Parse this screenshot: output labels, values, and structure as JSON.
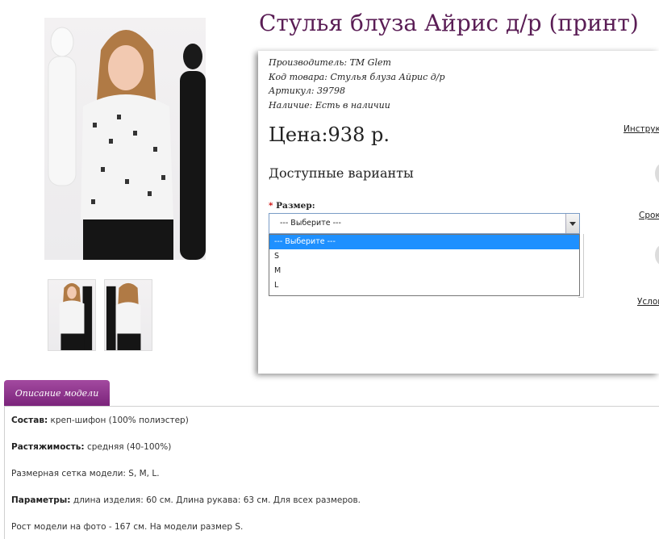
{
  "product": {
    "title": "Стулья блуза Айрис д/р (принт)"
  },
  "meta": {
    "manufacturer_label": "Производитель:",
    "manufacturer_value": "TM Glem",
    "code_label": "Код товара:",
    "code_value": "Стулья блуза Айрис д/р",
    "sku_label": "Артикул:",
    "sku_value": "39798",
    "stock_label": "Наличие:",
    "stock_value": "Есть в наличии"
  },
  "price": "Цена:938 р.",
  "variants_heading": "Доступные варианты",
  "size": {
    "label": "Размер:",
    "required_mark": "*",
    "selected": "--- Выберите ---",
    "options": [
      "--- Выберите ---",
      "S",
      "M",
      "L"
    ]
  },
  "right_links": {
    "instructions": "Инструк",
    "terms": "Срок",
    "conditions": "Услов"
  },
  "tab": {
    "label": "Описание модели"
  },
  "description": [
    {
      "label": "Состав:",
      "value": "креп-шифон (100% полиэстер)"
    },
    {
      "label": "Растяжимость:",
      "value": "средняя (40-100%)"
    },
    {
      "label": "",
      "value": "Размерная сетка модели: S, M, L."
    },
    {
      "label": "Параметры:",
      "value": "длина изделия: 60 см. Длина рукава: 63 см. Для всех размеров."
    },
    {
      "label": "",
      "value": "Рост модели на фото - 167 см. На модели размер S."
    }
  ],
  "colors": {
    "title": "#5a1d55",
    "tab": "#8b2d8a",
    "selected_option": "#1e90ff"
  }
}
